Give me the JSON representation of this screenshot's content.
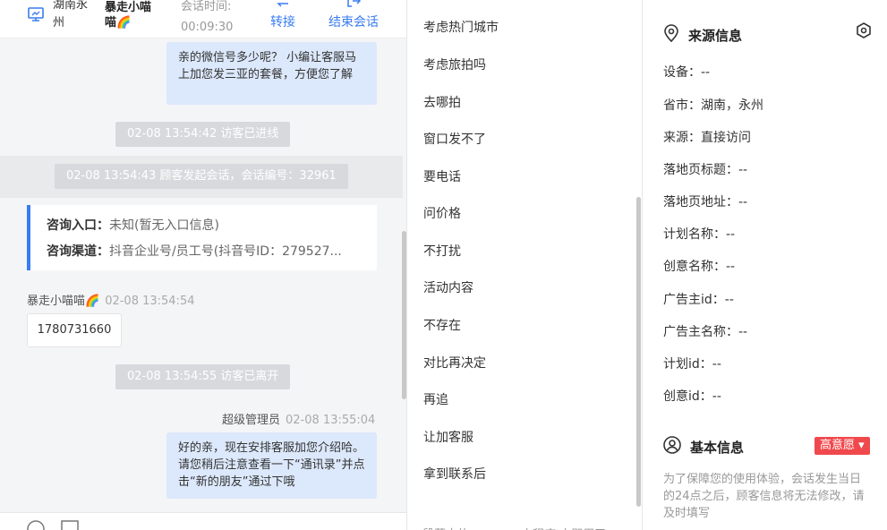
{
  "header": {
    "location": "湖南永州",
    "customer_name": "暴走小喵喵🌈",
    "session_time_label": "会话时间:",
    "session_time": "00:09:30",
    "transfer_label": "转接",
    "end_session_label": "结束会话"
  },
  "chat": {
    "msg1": "亲的微信号多少呢？ 小编让客服马上加您发三亚的套餐，方便您了解",
    "sys1": "02-08 13:54:42 访客已进线",
    "sys2": "02-08 13:54:43 顾客发起会话，会话编号：32961",
    "entry_label": "咨询入口：",
    "entry_value": "未知(暂无入口信息)",
    "channel_label": "咨询渠道：",
    "channel_value": "抖音企业号/员工号(抖音号ID：279527...",
    "customer_sender": "暴走小喵喵🌈",
    "customer_time": "02-08 13:54:54",
    "customer_msg": "1780731660",
    "sys3": "02-08 13:54:55 访客已离开",
    "agent_sender": "超级管理员",
    "agent_time": "02-08 13:55:04",
    "msg2": "好的亲，现在安排客服加您介绍哈。请您稍后注意查看一下“通讯录”并点击“新的朋友”通过下哦"
  },
  "quick_replies": [
    "考虑热门城市",
    "考虑旅拍吗",
    "去哪拍",
    "窗口发不了",
    "要电话",
    "问价格",
    "不打扰",
    "活动内容",
    "不存在",
    "对比再决定",
    "再追",
    "让加客服",
    "拿到联系后"
  ],
  "quick_reply_footer": [
    "一 段落中的",
    "一 小程序 立即用了"
  ],
  "source_info": {
    "title": "来源信息",
    "fields": [
      {
        "label": "设备：",
        "value": "--"
      },
      {
        "label": "省市：",
        "value": "湖南，永州"
      },
      {
        "label": "来源：",
        "value": "直接访问"
      },
      {
        "label": "落地页标题：",
        "value": "--"
      },
      {
        "label": "落地页地址：",
        "value": "--"
      },
      {
        "label": "计划名称：",
        "value": "--"
      },
      {
        "label": "创意名称：",
        "value": "--"
      },
      {
        "label": "广告主id：",
        "value": "--"
      },
      {
        "label": "广告主名称：",
        "value": "--"
      },
      {
        "label": "计划id：",
        "value": "--"
      },
      {
        "label": "创意id：",
        "value": "--"
      }
    ]
  },
  "basic_info": {
    "title": "基本信息",
    "intent_badge": "高意愿",
    "note": "为了保障您的使用体验，会话发生当日的24点之后，顾客信息将无法修改，请及时填写"
  },
  "colors": {
    "accent": "#3a7cf0",
    "bubble": "#dce8fb",
    "badge": "#f0494d"
  }
}
